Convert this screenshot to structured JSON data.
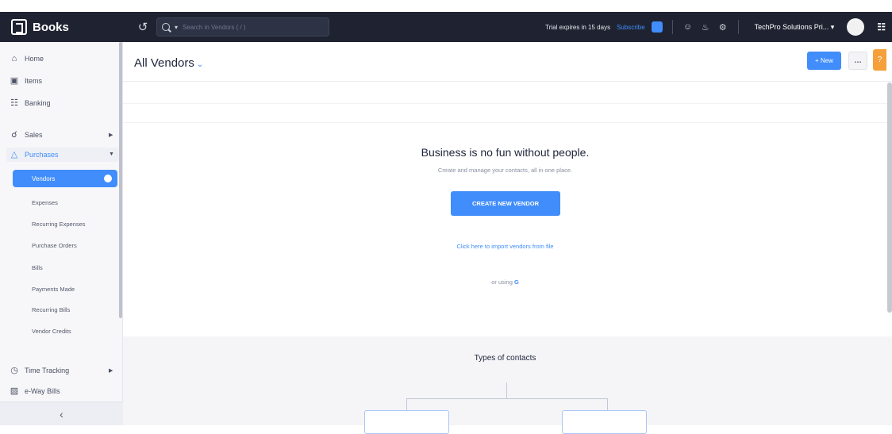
{
  "app": {
    "name": "Books"
  },
  "topbar": {
    "search_placeholder": "Search in Vendors ( / )",
    "trial_text": "Trial expires in 15 days",
    "subscribe": "Subscribe",
    "org_name": "TechPro Solutions Pri...",
    "icons": [
      "recent-icon",
      "search-icon",
      "subscribe-badge-icon",
      "people-icon",
      "bell-icon",
      "gear-icon",
      "apps-grid-icon"
    ]
  },
  "sidebar": {
    "home": "Home",
    "items": "Items",
    "banking": "Banking",
    "sales": "Sales",
    "purchases": "Purchases",
    "vendors": "Vendors",
    "expenses": "Expenses",
    "recurring_expenses": "Recurring Expenses",
    "purchase_orders": "Purchase Orders",
    "bills": "Bills",
    "payments_made": "Payments Made",
    "recurring_bills": "Recurring Bills",
    "vendor_credits": "Vendor Credits",
    "time_tracking": "Time Tracking",
    "eway_bills": "e-Way Bills"
  },
  "header": {
    "title": "All Vendors",
    "new_button": "+ New",
    "more": "…",
    "help": "?"
  },
  "empty_state": {
    "title": "Business is no fun without people.",
    "subtitle": "Create and manage your contacts, all in one place.",
    "create_button": "CREATE NEW VENDOR",
    "import_link": "Click here to import vendors from file",
    "or_using": "or using",
    "gsuite": "G"
  },
  "contacts": {
    "title": "Types of contacts"
  },
  "colors": {
    "accent": "#408dfb",
    "topbar": "#1f2331",
    "help": "#f6a03c"
  }
}
